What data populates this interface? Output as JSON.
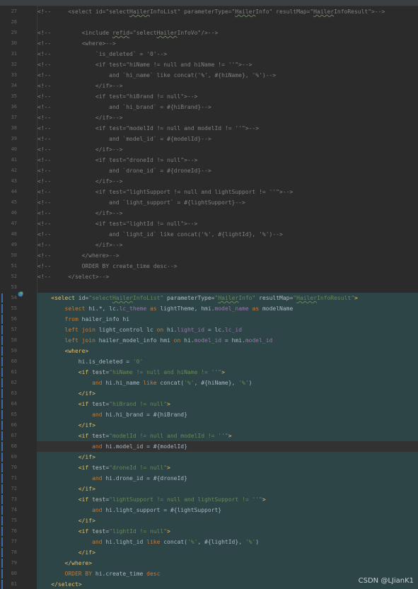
{
  "editor": {
    "watermark": "CSDN @LJianK1",
    "lines": [
      {
        "no": "27",
        "sel": false,
        "segs": [
          [
            "c",
            "<!--     <select id=\"select"
          ],
          [
            "c wavy",
            "Hailer"
          ],
          [
            "c",
            "InfoList\" parameterType=\""
          ],
          [
            "c wavy",
            "Hailer"
          ],
          [
            "c",
            "Info\" resultMap=\""
          ],
          [
            "c wavy",
            "Hailer"
          ],
          [
            "c",
            "InfoResult\">-->"
          ]
        ]
      },
      {
        "no": "28",
        "sel": false,
        "segs": []
      },
      {
        "no": "29",
        "sel": false,
        "segs": [
          [
            "c",
            "<!--         <include "
          ],
          [
            "c wavy",
            "refid"
          ],
          [
            "c",
            "=\"select"
          ],
          [
            "c wavy",
            "Hailer"
          ],
          [
            "c",
            "InfoVo\"/>-->"
          ]
        ]
      },
      {
        "no": "30",
        "sel": false,
        "segs": [
          [
            "c",
            "<!--         <where>-->"
          ]
        ]
      },
      {
        "no": "31",
        "sel": false,
        "segs": [
          [
            "c",
            "<!--             `is_deleted` = '0'-->"
          ]
        ]
      },
      {
        "no": "32",
        "sel": false,
        "segs": [
          [
            "c",
            "<!--             <if test=\"hiName != null and hiName != ''\">-->"
          ]
        ]
      },
      {
        "no": "33",
        "sel": false,
        "segs": [
          [
            "c",
            "<!--                 and `hi_name` like concat('%', #{hiName}, '%')-->"
          ]
        ]
      },
      {
        "no": "34",
        "sel": false,
        "segs": [
          [
            "c",
            "<!--             </if>-->"
          ]
        ]
      },
      {
        "no": "35",
        "sel": false,
        "segs": [
          [
            "c",
            "<!--             <if test=\"hiBrand != null\">-->"
          ]
        ]
      },
      {
        "no": "36",
        "sel": false,
        "segs": [
          [
            "c",
            "<!--                 and `hi_brand` = #{hiBrand}-->"
          ]
        ]
      },
      {
        "no": "37",
        "sel": false,
        "segs": [
          [
            "c",
            "<!--             </if>-->"
          ]
        ]
      },
      {
        "no": "38",
        "sel": false,
        "segs": [
          [
            "c",
            "<!--             <if test=\"modelId != null and modelId != ''\">-->"
          ]
        ]
      },
      {
        "no": "39",
        "sel": false,
        "segs": [
          [
            "c",
            "<!--                 and `model_id` = #{modelId}-->"
          ]
        ]
      },
      {
        "no": "40",
        "sel": false,
        "segs": [
          [
            "c",
            "<!--             </if>-->"
          ]
        ]
      },
      {
        "no": "41",
        "sel": false,
        "segs": [
          [
            "c",
            "<!--             <if test=\"droneId != null\">-->"
          ]
        ]
      },
      {
        "no": "42",
        "sel": false,
        "segs": [
          [
            "c",
            "<!--                 and `drone_id` = #{droneId}-->"
          ]
        ]
      },
      {
        "no": "43",
        "sel": false,
        "segs": [
          [
            "c",
            "<!--             </if>-->"
          ]
        ]
      },
      {
        "no": "44",
        "sel": false,
        "segs": [
          [
            "c",
            "<!--             <if test=\"lightSupport != null and lightSupport != ''\">-->"
          ]
        ]
      },
      {
        "no": "45",
        "sel": false,
        "segs": [
          [
            "c",
            "<!--                 and `light_support` = #{lightSupport}-->"
          ]
        ]
      },
      {
        "no": "46",
        "sel": false,
        "segs": [
          [
            "c",
            "<!--             </if>-->"
          ]
        ]
      },
      {
        "no": "47",
        "sel": false,
        "segs": [
          [
            "c",
            "<!--             <if test=\"lightId != null\">-->"
          ]
        ]
      },
      {
        "no": "48",
        "sel": false,
        "segs": [
          [
            "c",
            "<!--                 and `light_id` like concat('%', #{lightId}, '%')-->"
          ]
        ]
      },
      {
        "no": "49",
        "sel": false,
        "segs": [
          [
            "c",
            "<!--             </if>-->"
          ]
        ]
      },
      {
        "no": "50",
        "sel": false,
        "segs": [
          [
            "c",
            "<!--         </where>-->"
          ]
        ]
      },
      {
        "no": "51",
        "sel": false,
        "segs": [
          [
            "c",
            "<!--         ORDER BY create_time desc-->"
          ]
        ]
      },
      {
        "no": "52",
        "sel": false,
        "segs": [
          [
            "c",
            "<!--     </select>-->"
          ]
        ]
      },
      {
        "no": "53",
        "sel": false,
        "segs": []
      },
      {
        "no": "54",
        "sel": true,
        "segs": [
          [
            "pl",
            "    "
          ],
          [
            "tag",
            "<select "
          ],
          [
            "an",
            "id="
          ],
          [
            "av",
            "\"select"
          ],
          [
            "av wavy",
            "Hailer"
          ],
          [
            "av",
            "InfoList\" "
          ],
          [
            "an",
            "parameterType="
          ],
          [
            "av",
            "\""
          ],
          [
            "av wavy",
            "Hailer"
          ],
          [
            "av",
            "Info\" "
          ],
          [
            "an",
            "resultMap="
          ],
          [
            "av",
            "\""
          ],
          [
            "av wavy",
            "Hailer"
          ],
          [
            "av",
            "InfoResult\""
          ],
          [
            "tag",
            ">"
          ]
        ]
      },
      {
        "no": "55",
        "sel": true,
        "segs": [
          [
            "pl",
            "        "
          ],
          [
            "kw",
            "select "
          ],
          [
            "pl",
            "hi.*, lc."
          ],
          [
            "fld",
            "lc_theme"
          ],
          [
            "pl",
            " "
          ],
          [
            "kw",
            "as"
          ],
          [
            "pl",
            " lightTheme, hmi."
          ],
          [
            "fld",
            "model_name"
          ],
          [
            "pl",
            " "
          ],
          [
            "kw",
            "as"
          ],
          [
            "pl",
            " modelName"
          ]
        ]
      },
      {
        "no": "56",
        "sel": true,
        "segs": [
          [
            "pl",
            "        "
          ],
          [
            "kw",
            "from "
          ],
          [
            "pl",
            "hailer_info hi"
          ]
        ]
      },
      {
        "no": "57",
        "sel": true,
        "segs": [
          [
            "pl",
            "        "
          ],
          [
            "kw",
            "left join "
          ],
          [
            "pl",
            "light_control lc "
          ],
          [
            "kw",
            "on"
          ],
          [
            "pl",
            " hi."
          ],
          [
            "fld",
            "light_id"
          ],
          [
            "pl",
            " = lc."
          ],
          [
            "fld",
            "lc_id"
          ]
        ]
      },
      {
        "no": "58",
        "sel": true,
        "segs": [
          [
            "pl",
            "        "
          ],
          [
            "kw",
            "left join "
          ],
          [
            "pl",
            "hailer_model_info hmi "
          ],
          [
            "kw",
            "on"
          ],
          [
            "pl",
            " hi."
          ],
          [
            "fld",
            "model_id"
          ],
          [
            "pl",
            " = hmi."
          ],
          [
            "fld",
            "model_id"
          ]
        ]
      },
      {
        "no": "59",
        "sel": true,
        "segs": [
          [
            "pl",
            "        "
          ],
          [
            "tag",
            "<where>"
          ]
        ]
      },
      {
        "no": "60",
        "sel": true,
        "segs": [
          [
            "pl",
            "            hi.is_deleted = "
          ],
          [
            "str",
            "'0'"
          ]
        ]
      },
      {
        "no": "61",
        "sel": true,
        "segs": [
          [
            "pl",
            "            "
          ],
          [
            "tag",
            "<if "
          ],
          [
            "an",
            "test="
          ],
          [
            "av",
            "\"hiName != null and hiName != ''\""
          ],
          [
            "tag",
            ">"
          ]
        ]
      },
      {
        "no": "62",
        "sel": true,
        "segs": [
          [
            "pl",
            "                "
          ],
          [
            "kw",
            "and"
          ],
          [
            "pl",
            " hi.hi_name "
          ],
          [
            "kw",
            "like"
          ],
          [
            "pl",
            " concat("
          ],
          [
            "str",
            "'%'"
          ],
          [
            "pl",
            ", #{hiName}, "
          ],
          [
            "str",
            "'%'"
          ],
          [
            "pl",
            ")"
          ]
        ]
      },
      {
        "no": "63",
        "sel": true,
        "segs": [
          [
            "pl",
            "            "
          ],
          [
            "tag",
            "</if>"
          ]
        ]
      },
      {
        "no": "64",
        "sel": true,
        "segs": [
          [
            "pl",
            "            "
          ],
          [
            "tag",
            "<if "
          ],
          [
            "an",
            "test="
          ],
          [
            "av",
            "\"hiBrand != null\""
          ],
          [
            "tag",
            ">"
          ]
        ]
      },
      {
        "no": "65",
        "sel": true,
        "segs": [
          [
            "pl",
            "                "
          ],
          [
            "kw",
            "and"
          ],
          [
            "pl",
            " hi.hi_brand = #{hiBrand}"
          ]
        ]
      },
      {
        "no": "66",
        "sel": true,
        "segs": [
          [
            "pl",
            "            "
          ],
          [
            "tag",
            "</if>"
          ]
        ]
      },
      {
        "no": "67",
        "sel": true,
        "segs": [
          [
            "pl",
            "            "
          ],
          [
            "tag",
            "<if "
          ],
          [
            "an",
            "test="
          ],
          [
            "av",
            "\"modelId != null and modelId != ''\""
          ],
          [
            "tag",
            ">"
          ]
        ]
      },
      {
        "no": "68",
        "sel": true,
        "cur": true,
        "segs": [
          [
            "pl",
            "                "
          ],
          [
            "kw",
            "and"
          ],
          [
            "pl",
            " hi.model_id = #{modelId}"
          ]
        ]
      },
      {
        "no": "69",
        "sel": true,
        "segs": [
          [
            "pl",
            "            "
          ],
          [
            "tag",
            "</if>"
          ]
        ]
      },
      {
        "no": "70",
        "sel": true,
        "segs": [
          [
            "pl",
            "            "
          ],
          [
            "tag",
            "<if "
          ],
          [
            "an",
            "test="
          ],
          [
            "av",
            "\"droneId != null\""
          ],
          [
            "tag",
            ">"
          ]
        ]
      },
      {
        "no": "71",
        "sel": true,
        "segs": [
          [
            "pl",
            "                "
          ],
          [
            "kw",
            "and"
          ],
          [
            "pl",
            " hi.drone_id = #{droneId}"
          ]
        ]
      },
      {
        "no": "72",
        "sel": true,
        "segs": [
          [
            "pl",
            "            "
          ],
          [
            "tag",
            "</if>"
          ]
        ]
      },
      {
        "no": "73",
        "sel": true,
        "segs": [
          [
            "pl",
            "            "
          ],
          [
            "tag",
            "<if "
          ],
          [
            "an",
            "test="
          ],
          [
            "av",
            "\"lightSupport != null and lightSupport != ''\""
          ],
          [
            "tag",
            ">"
          ]
        ]
      },
      {
        "no": "74",
        "sel": true,
        "segs": [
          [
            "pl",
            "                "
          ],
          [
            "kw",
            "and"
          ],
          [
            "pl",
            " hi.light_support = #{lightSupport}"
          ]
        ]
      },
      {
        "no": "75",
        "sel": true,
        "segs": [
          [
            "pl",
            "            "
          ],
          [
            "tag",
            "</if>"
          ]
        ]
      },
      {
        "no": "76",
        "sel": true,
        "segs": [
          [
            "pl",
            "            "
          ],
          [
            "tag",
            "<if "
          ],
          [
            "an",
            "test="
          ],
          [
            "av",
            "\"lightId != null\""
          ],
          [
            "tag",
            ">"
          ]
        ]
      },
      {
        "no": "77",
        "sel": true,
        "segs": [
          [
            "pl",
            "                "
          ],
          [
            "kw",
            "and"
          ],
          [
            "pl",
            " hi.light_id "
          ],
          [
            "kw",
            "like"
          ],
          [
            "pl",
            " concat("
          ],
          [
            "str",
            "'%'"
          ],
          [
            "pl",
            ", #{lightId}, "
          ],
          [
            "str",
            "'%'"
          ],
          [
            "pl",
            ")"
          ]
        ]
      },
      {
        "no": "78",
        "sel": true,
        "segs": [
          [
            "pl",
            "            "
          ],
          [
            "tag",
            "</if>"
          ]
        ]
      },
      {
        "no": "79",
        "sel": true,
        "segs": [
          [
            "pl",
            "        "
          ],
          [
            "tag",
            "</where>"
          ]
        ]
      },
      {
        "no": "80",
        "sel": true,
        "segs": [
          [
            "pl",
            "        "
          ],
          [
            "kw",
            "ORDER BY "
          ],
          [
            "pl",
            "hi.create_time "
          ],
          [
            "kw",
            "desc"
          ]
        ]
      },
      {
        "no": "81",
        "sel": true,
        "segs": [
          [
            "pl",
            "    "
          ],
          [
            "tag",
            "</select>"
          ]
        ]
      }
    ]
  },
  "colors": {
    "background": "#2b2b2b",
    "selection": "#2d4546",
    "comment": "#808080",
    "tag": "#e8bf6a",
    "keyword": "#cc7832",
    "string": "#6a8759",
    "field": "#9876aa"
  }
}
